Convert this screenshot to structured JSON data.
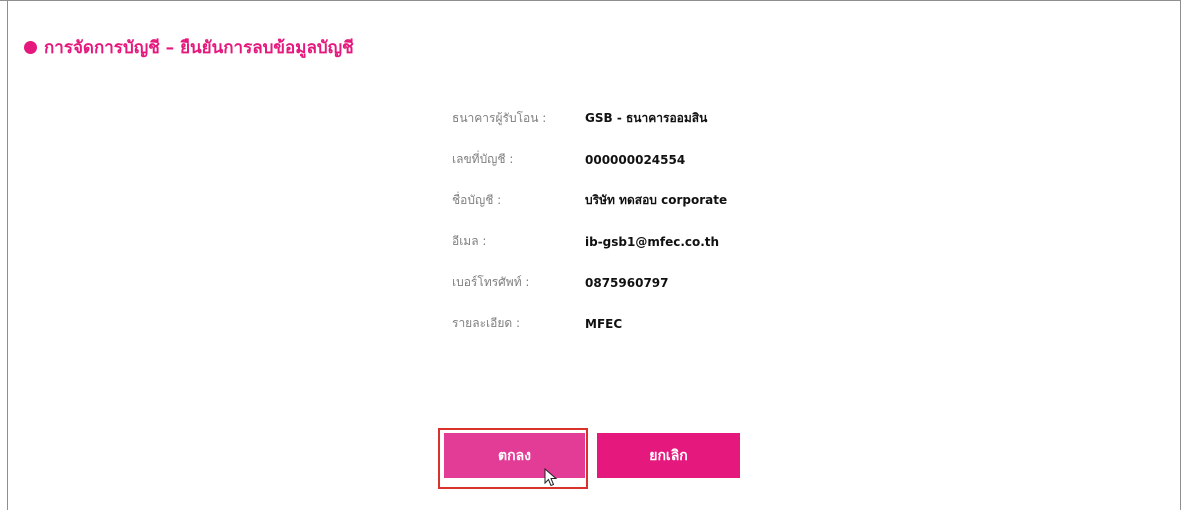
{
  "colors": {
    "brand": "#e5197d",
    "confirm_button": "#e23c97",
    "cancel_button": "#e5197d",
    "highlight_border": "#d9322d",
    "label_text": "#808080",
    "value_text": "#111111"
  },
  "header": {
    "bullet_icon": "filled-circle",
    "title": "การจัดการบัญชี – ยืนยันการลบข้อมูลบัญชี"
  },
  "details": [
    {
      "label": "ธนาคารผู้รับโอน :",
      "value": "GSB - ธนาคารออมสิน"
    },
    {
      "label": "เลขที่บัญชี :",
      "value": "000000024554"
    },
    {
      "label": "ชื่อบัญชี :",
      "value": "บริษัท ทดสอบ corporate"
    },
    {
      "label": "อีเมล :",
      "value": "ib-gsb1@mfec.co.th"
    },
    {
      "label": "เบอร์โทรศัพท์ :",
      "value": "0875960797"
    },
    {
      "label": "รายละเอียด :",
      "value": "MFEC"
    }
  ],
  "buttons": {
    "confirm_label": "ตกลง",
    "cancel_label": "ยกเลิก"
  },
  "cursor_icon": "mouse-pointer"
}
